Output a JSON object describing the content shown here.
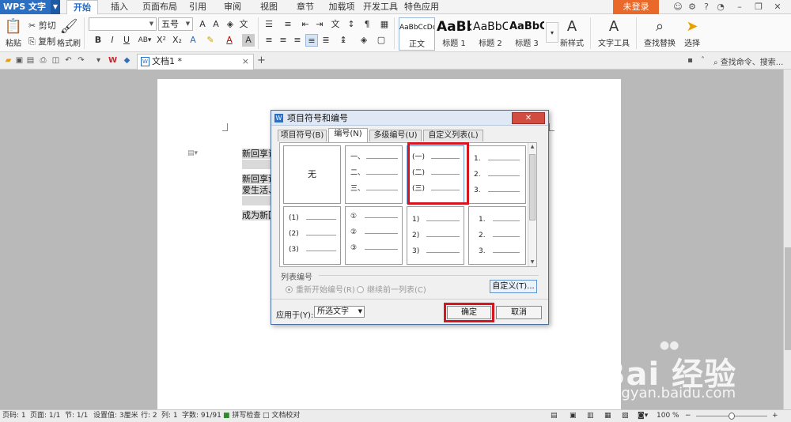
{
  "menubar": {
    "app_name": "WPS 文字",
    "tabs": [
      "开始",
      "插入",
      "页面布局",
      "引用",
      "审阅",
      "视图",
      "章节",
      "加载项",
      "开发工具",
      "特色应用"
    ],
    "active_tab": "开始",
    "login": "未登录"
  },
  "ribbon": {
    "paste": "粘贴",
    "cut": "剪切",
    "copy": "复制",
    "format_painter": "格式刷",
    "font_name": "",
    "font_size": "五号",
    "styles": [
      {
        "sample": "AaBbCcDd",
        "name": "正文"
      },
      {
        "sample": "AaBb",
        "name": "标题 1"
      },
      {
        "sample": "AaBbC",
        "name": "标题 2"
      },
      {
        "sample": "AaBbC",
        "name": "标题 3"
      }
    ],
    "new_style": "新样式",
    "text_tools": "文字工具",
    "find_replace": "查找替换",
    "select": "选择"
  },
  "quickbar": {
    "doc_tab": "文档1 *",
    "search_cmd": "查找命令、搜索..."
  },
  "document": {
    "lines": [
      "新回享说",
      "新回享说",
      "爱生活、",
      "成为新回"
    ]
  },
  "dialog": {
    "title": "项目符号和编号",
    "tabs": [
      "项目符号(B)",
      "编号(N)",
      "多级编号(U)",
      "自定义列表(L)"
    ],
    "active_tab": "编号(N)",
    "none_label": "无",
    "cells": [
      [
        "一、",
        "二、",
        "三、"
      ],
      [
        "(一)",
        "(二)",
        "(三)"
      ],
      [
        "1.",
        "2.",
        "3."
      ],
      [
        "(1)",
        "(2)",
        "(3)"
      ],
      [
        "①",
        "②",
        "③"
      ],
      [
        "1)",
        "2)",
        "3)"
      ],
      [
        "1.",
        "2.",
        "3."
      ]
    ],
    "list_group": "列表编号",
    "restart": "重新开始编号(R)",
    "continue": "继续前一列表(C)",
    "custom": "自定义(T)...",
    "apply_to_label": "应用于(Y):",
    "apply_to_value": "所选文字",
    "ok": "确定",
    "cancel": "取消"
  },
  "statusbar": {
    "page_num": "页码: 1",
    "pages": "页面: 1/1",
    "section": "节: 1/1",
    "setting": "设置值: 3厘米",
    "row": "行: 2",
    "col": "列: 1",
    "words": "字数: 91/91",
    "spell": "拼写检查",
    "proof": "文档校对",
    "zoom": "100 %"
  },
  "watermark": {
    "main": "Bai 经验",
    "sub": "jingyan.baidu.com"
  },
  "colors": {
    "accent": "#2b6fc2",
    "login": "#e8692a",
    "highlight": "#d6161f"
  }
}
